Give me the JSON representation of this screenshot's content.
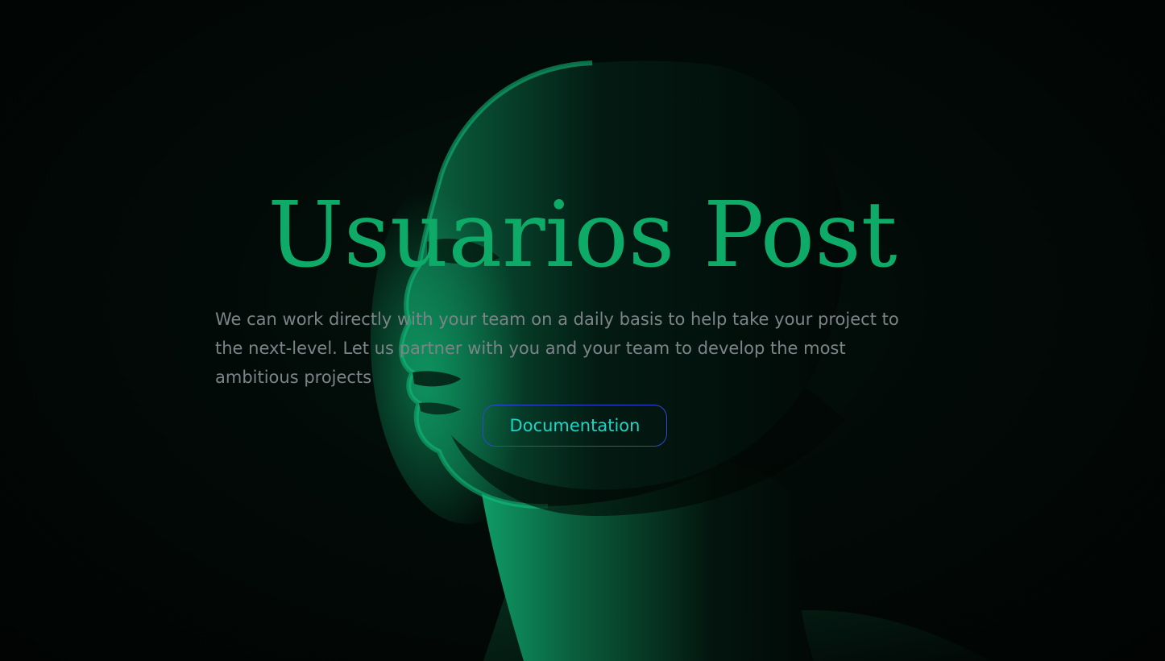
{
  "hero": {
    "title": "Usuarios Post",
    "description": "We can work directly with your team on a daily basis to help take your project to the next-level. Let us partner with you and your team to develop the most ambitious projects",
    "button_label": "Documentation"
  },
  "colors": {
    "background": "#020806",
    "title": "#0eaa68",
    "body_text": "#7d8487",
    "button_text": "#22d3c5",
    "button_border": "#2f47d8"
  }
}
